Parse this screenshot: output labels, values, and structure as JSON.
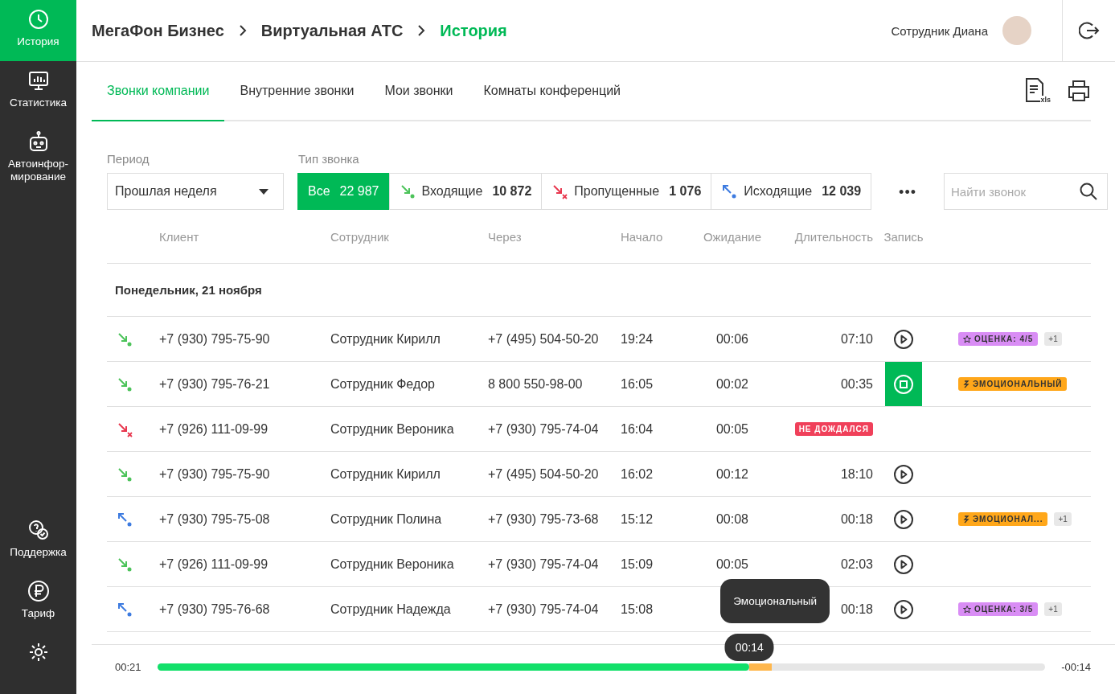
{
  "sidebar": {
    "items": [
      {
        "label": "История",
        "selected": true
      },
      {
        "label": "Статистика",
        "selected": false
      },
      {
        "label": "Автоинфор-мирование",
        "selected": false
      }
    ],
    "bottom_items": [
      {
        "label": "Поддержка",
        "selected": false
      },
      {
        "label": "Тариф",
        "selected": false
      },
      {
        "selected": false
      }
    ]
  },
  "breadcrumb": [
    {
      "label": "МегаФон Бизнес",
      "current": false
    },
    {
      "label": "Виртуальная АТС",
      "current": false
    },
    {
      "label": "История",
      "current": true
    }
  ],
  "user": {
    "name": "Сотрудник Диана"
  },
  "tabs": [
    {
      "label": "Звонки компании",
      "selected": true
    },
    {
      "label": "Внутренние звонки",
      "selected": false
    },
    {
      "label": "Мои звонки",
      "selected": false
    },
    {
      "label": "Комнаты конференций",
      "selected": false
    }
  ],
  "export": {
    "xls_label": "xls"
  },
  "filters": {
    "period": {
      "label": "Период",
      "value": "Прошлая неделя"
    },
    "call_type": {
      "label": "Тип звонка",
      "options": [
        {
          "kind": "all",
          "label": "Все",
          "count": "22 987",
          "selected": true
        },
        {
          "kind": "incoming",
          "label": "Входящие",
          "count": "10 872",
          "selected": false
        },
        {
          "kind": "missed",
          "label": "Пропущенные",
          "count": "1 076",
          "selected": false
        },
        {
          "kind": "outgoing",
          "label": "Исходящие",
          "count": "12 039",
          "selected": false
        }
      ]
    },
    "more": "•••",
    "search": {
      "placeholder": "Найти звонок"
    }
  },
  "table": {
    "columns": [
      "Клиент",
      "Сотрудник",
      "Через",
      "Начало",
      "Ожидание",
      "Длительность",
      "Запись"
    ],
    "groups": [
      {
        "title": "Понедельник, 21 ноября",
        "rows": [
          {
            "kind": "incoming",
            "client": "+7 (930) 795-75-90",
            "employee": "Сотрудник Кирилл",
            "via": "+7 (495) 504-50-20",
            "start": "19:24",
            "wait": "00:06",
            "duration": "07:10",
            "playing": false,
            "tags": [
              {
                "kind": "rating",
                "text": "ОЦЕНКА: 4/5"
              }
            ],
            "more": "+1"
          },
          {
            "kind": "incoming",
            "client": "+7 (930) 795-76-21",
            "employee": "Сотрудник Федор",
            "via": "8 800 550-98-00",
            "start": "16:05",
            "wait": "00:02",
            "duration": "00:35",
            "playing": true,
            "tags": [
              {
                "kind": "emotion",
                "text": "ЭМОЦИОНАЛЬНЫЙ"
              }
            ]
          },
          {
            "kind": "missed",
            "client": "+7 (926) 111-09-99",
            "employee": "Сотрудник Вероника",
            "via": "+7 (930) 795-74-04",
            "start": "16:04",
            "wait": "00:05",
            "status": "НЕ ДОЖДАЛСЯ",
            "tags": []
          },
          {
            "kind": "incoming",
            "client": "+7 (930) 795-75-90",
            "employee": "Сотрудник Кирилл",
            "via": "+7 (495) 504-50-20",
            "start": "16:02",
            "wait": "00:12",
            "duration": "18:10",
            "playing": false,
            "tags": []
          },
          {
            "kind": "outgoing",
            "client": "+7 (930) 795-75-08",
            "employee": "Сотрудник Полина",
            "via": "+7 (930) 795-73-68",
            "start": "15:12",
            "wait": "00:08",
            "duration": "00:18",
            "playing": false,
            "tags": [
              {
                "kind": "emotion",
                "text": "ЭМОЦИОНАЛ..."
              }
            ],
            "more": "+1"
          },
          {
            "kind": "incoming",
            "client": "+7 (926) 111-09-99",
            "employee": "Сотрудник Вероника",
            "via": "+7 (930) 795-74-04",
            "start": "15:09",
            "wait": "00:05",
            "duration": "02:03",
            "playing": false,
            "tags": []
          },
          {
            "kind": "outgoing",
            "client": "+7 (930) 795-76-68",
            "employee": "Сотрудник Надежда",
            "via": "+7 (930) 795-74-04",
            "start": "15:08",
            "duration": "00:18",
            "playing": false,
            "tags": [
              {
                "kind": "rating",
                "text": "ОЦЕНКА: 3/5"
              }
            ],
            "more": "+1"
          }
        ]
      }
    ]
  },
  "player": {
    "elapsed": "00:21",
    "remaining": "-00:14",
    "level": 0.667,
    "marker_time": "00:14",
    "tooltip": "Эмоциональный"
  }
}
